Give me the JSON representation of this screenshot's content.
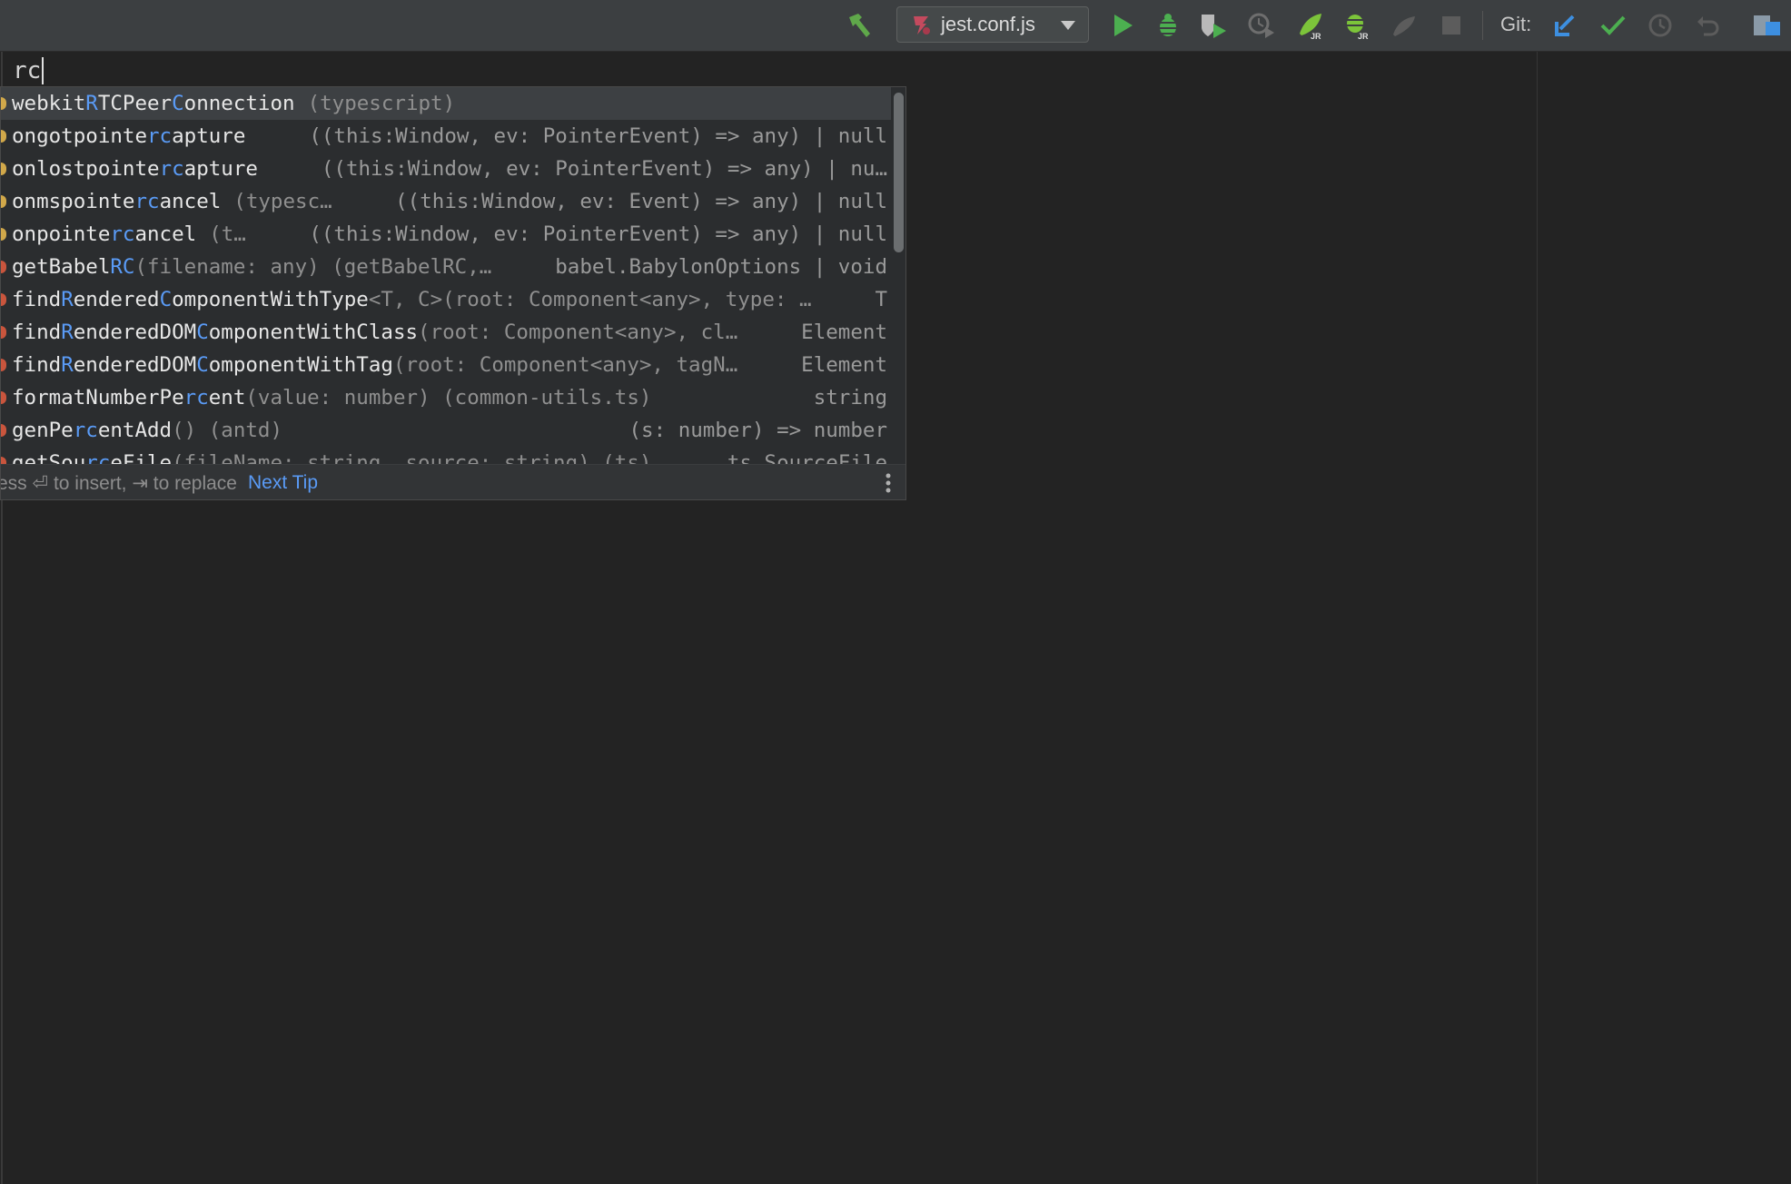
{
  "toolbar": {
    "run_config_label": "jest.conf.js",
    "git_label": "Git:",
    "icons": [
      "build-hammer-icon",
      "run-icon",
      "debug-icon",
      "coverage-icon",
      "profile-icon",
      "run-jrebel-icon",
      "debug-jrebel-icon",
      "attach-icon",
      "stop-icon",
      "git-update-icon",
      "git-commit-icon",
      "git-history-icon",
      "git-rollback-icon",
      "project-structure-icon"
    ]
  },
  "editor": {
    "typed_text": "rc"
  },
  "completion": {
    "items": [
      {
        "name_parts": [
          [
            "webkit",
            false
          ],
          [
            "R",
            true
          ],
          [
            "TCPeer",
            false
          ],
          [
            "C",
            true
          ],
          [
            "onnection",
            false
          ]
        ],
        "tail": "(typescript)",
        "type": "",
        "selected": true,
        "kind_color": "#d1a84a"
      },
      {
        "name_parts": [
          [
            "ongotpointe",
            false
          ],
          [
            "rc",
            true
          ],
          [
            "apture",
            false
          ]
        ],
        "tail": "",
        "type": "((this:Window, ev: PointerEvent) => any) | null",
        "selected": false,
        "kind_color": "#d1a84a"
      },
      {
        "name_parts": [
          [
            "onlostpointe",
            false
          ],
          [
            "rc",
            true
          ],
          [
            "apture",
            false
          ]
        ],
        "tail": "",
        "type": "((this:Window, ev: PointerEvent) => any) | nu…",
        "selected": false,
        "kind_color": "#d1a84a"
      },
      {
        "name_parts": [
          [
            "onmspointe",
            false
          ],
          [
            "rc",
            true
          ],
          [
            "ancel",
            false
          ]
        ],
        "tail": "(typesc…",
        "type": "((this:Window, ev: Event) => any) | null",
        "selected": false,
        "kind_color": "#d1a84a"
      },
      {
        "name_parts": [
          [
            "onpointe",
            false
          ],
          [
            "rc",
            true
          ],
          [
            "ancel",
            false
          ]
        ],
        "tail": "(t…",
        "type": "((this:Window, ev: PointerEvent) => any) | null",
        "selected": false,
        "kind_color": "#d1a84a"
      },
      {
        "name_parts": [
          [
            "getBabel",
            false
          ],
          [
            "RC",
            true
          ]
        ],
        "tail": "(filename: any) (getBabelRC,…",
        "type": "babel.BabylonOptions | void",
        "selected": false,
        "kind_color": "#c9553d"
      },
      {
        "name_parts": [
          [
            "find",
            false
          ],
          [
            "R",
            true
          ],
          [
            "endered",
            false
          ],
          [
            "C",
            true
          ],
          [
            "omponentWithType",
            false
          ]
        ],
        "tail": "<T, C>(root: Component<any>, type: …",
        "type": "T",
        "selected": false,
        "kind_color": "#c9553d"
      },
      {
        "name_parts": [
          [
            "find",
            false
          ],
          [
            "R",
            true
          ],
          [
            "enderedDOM",
            false
          ],
          [
            "C",
            true
          ],
          [
            "omponentWithClass",
            false
          ]
        ],
        "tail": "(root: Component<any>, cl…",
        "type": "Element",
        "selected": false,
        "kind_color": "#c9553d"
      },
      {
        "name_parts": [
          [
            "find",
            false
          ],
          [
            "R",
            true
          ],
          [
            "enderedDOM",
            false
          ],
          [
            "C",
            true
          ],
          [
            "omponentWithTag",
            false
          ]
        ],
        "tail": "(root: Component<any>, tagN…",
        "type": "Element",
        "selected": false,
        "kind_color": "#c9553d"
      },
      {
        "name_parts": [
          [
            "formatNumberPe",
            false
          ],
          [
            "rc",
            true
          ],
          [
            "ent",
            false
          ]
        ],
        "tail": "(value: number) (common-utils.ts)",
        "type": "string",
        "selected": false,
        "kind_color": "#c9553d"
      },
      {
        "name_parts": [
          [
            "genPe",
            false
          ],
          [
            "rc",
            true
          ],
          [
            "entAdd",
            false
          ]
        ],
        "tail": "() (antd)",
        "type": "(s: number) => number",
        "selected": false,
        "kind_color": "#c9553d"
      },
      {
        "name_parts": [
          [
            "getSou",
            false
          ],
          [
            "rc",
            true
          ],
          [
            "eFile",
            false
          ]
        ],
        "tail": "(fileName: string, source: string) (ts)",
        "type": "ts.SourceFile",
        "selected": false,
        "kind_color": "#c9553d"
      }
    ],
    "footer_hint": "ess ⏎ to insert, ⇥ to replace",
    "footer_tip": "Next Tip"
  }
}
